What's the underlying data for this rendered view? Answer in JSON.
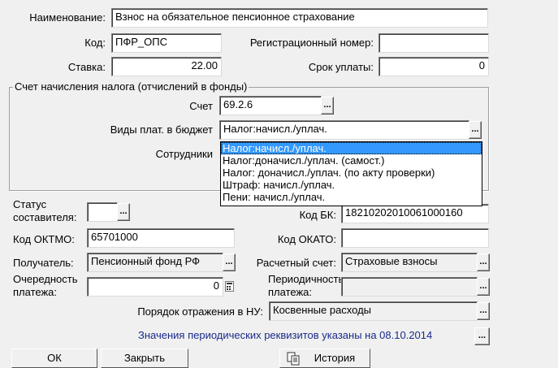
{
  "fields": {
    "name_label": "Наименование:",
    "name_value": "Взнос на обязательное пенсионное страхование",
    "code_label": "Код:",
    "code_value": "ПФР_ОПС",
    "reg_label": "Регистрационный номер:",
    "reg_value": "",
    "rate_label": "Ставка:",
    "rate_value": "22.00",
    "term_label": "Срок уплаты:",
    "term_value": "0"
  },
  "group": {
    "title": "Счет начисления налога (отчислений в фонды)",
    "account_label": "Счет",
    "account_value": "69.2.6",
    "paytypes_label": "Виды плат. в бюджет",
    "paytypes_value": "Налог:начисл./уплач.",
    "employees_label": "Сотрудники"
  },
  "dropdown": {
    "options": [
      "Налог:начисл./уплач.",
      "Налог:доначисл./уплач. (самост.)",
      "Налог: доначисл./уплач. (по акту проверки)",
      "Штраф: начисл./уплач.",
      "Пени: начисл./уплач."
    ]
  },
  "payment": {
    "status_label_1": "Статус",
    "status_label_2": "составителя:",
    "status_value": "",
    "kbk_label": "Код БК:",
    "kbk_value": "18210202010061000160",
    "oktmo_label": "Код ОКТМО:",
    "oktmo_value": "65701000",
    "okato_label": "Код ОКАТО:",
    "okato_value": "",
    "recipient_label": "Получатель:",
    "recipient_value": "Пенсионный фонд РФ",
    "account_label": "Расчетный счет:",
    "account_value": "Страховые взносы",
    "order_label_1": "Очередность",
    "order_label_2": "платежа:",
    "order_value": "0",
    "period_label_1": "Периодичность",
    "period_label_2": "платежа:",
    "period_value": "",
    "nu_label": "Порядок отражения в НУ:",
    "nu_value": "Косвенные расходы",
    "periodic_note": "Значения периодических реквизитов указаны на 08.10.2014"
  },
  "buttons": {
    "ok": "ОК",
    "close": "Закрыть",
    "history": "История",
    "ellipsis": "..."
  }
}
